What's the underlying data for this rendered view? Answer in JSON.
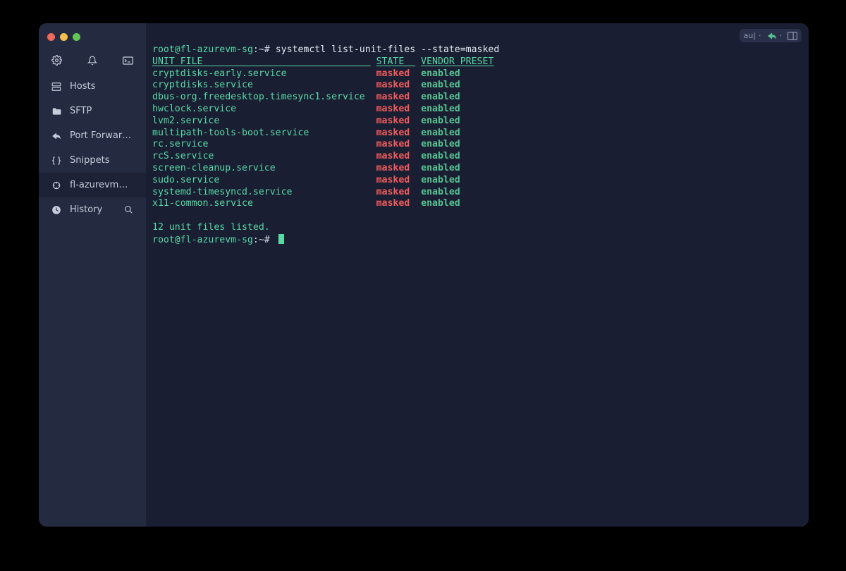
{
  "sidebar": {
    "items": [
      {
        "label": "Hosts"
      },
      {
        "label": "SFTP"
      },
      {
        "label": "Port Forwarding"
      },
      {
        "label": "Snippets"
      },
      {
        "label": "fl-azurevm…"
      },
      {
        "label": "History"
      }
    ]
  },
  "topbar": {
    "tag": "au|"
  },
  "terminal": {
    "prompt_user_host": "root@fl-azurevm-sg",
    "prompt_tail": ":~#",
    "command": "systemctl list-unit-files --state=masked",
    "headers": {
      "unit": "UNIT FILE",
      "state": "STATE",
      "preset": "VENDOR PRESET"
    },
    "rows": [
      {
        "unit": "cryptdisks-early.service",
        "state": "masked",
        "preset": "enabled"
      },
      {
        "unit": "cryptdisks.service",
        "state": "masked",
        "preset": "enabled"
      },
      {
        "unit": "dbus-org.freedesktop.timesync1.service",
        "state": "masked",
        "preset": "enabled"
      },
      {
        "unit": "hwclock.service",
        "state": "masked",
        "preset": "enabled"
      },
      {
        "unit": "lvm2.service",
        "state": "masked",
        "preset": "enabled"
      },
      {
        "unit": "multipath-tools-boot.service",
        "state": "masked",
        "preset": "enabled"
      },
      {
        "unit": "rc.service",
        "state": "masked",
        "preset": "enabled"
      },
      {
        "unit": "rcS.service",
        "state": "masked",
        "preset": "enabled"
      },
      {
        "unit": "screen-cleanup.service",
        "state": "masked",
        "preset": "enabled"
      },
      {
        "unit": "sudo.service",
        "state": "masked",
        "preset": "enabled"
      },
      {
        "unit": "systemd-timesyncd.service",
        "state": "masked",
        "preset": "enabled"
      },
      {
        "unit": "x11-common.service",
        "state": "masked",
        "preset": "enabled"
      }
    ],
    "summary": "12 unit files listed.",
    "col_widths": {
      "unit": 39,
      "state": 7
    }
  }
}
